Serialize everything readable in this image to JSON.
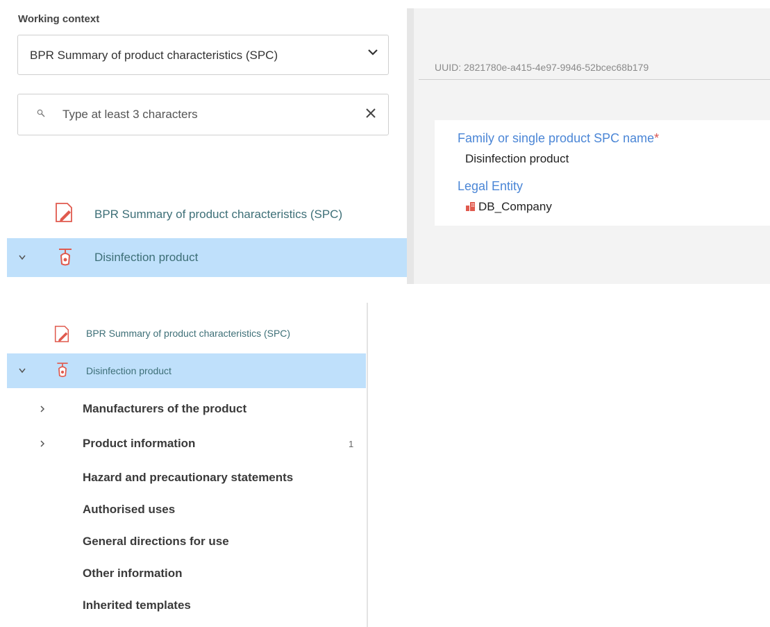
{
  "working_context": {
    "label": "Working context",
    "selected": "BPR Summary of product characteristics (SPC)"
  },
  "search": {
    "placeholder": "Type at least 3 characters"
  },
  "tree": {
    "root_label": "BPR Summary of product characteristics (SPC)",
    "product_label": "Disinfection product"
  },
  "detail": {
    "uuid_text": "UUID: 2821780e-a415-4e97-9946-52bcec68b179",
    "name_label": "Family or single product SPC name",
    "required_mark": "*",
    "name_value": "Disinfection product",
    "legal_entity_label": "Legal Entity",
    "legal_entity_value": "DB_Company"
  },
  "tree2": {
    "root_label": "BPR Summary of product characteristics (SPC)",
    "product_label": "Disinfection product",
    "sections": [
      {
        "label": "Manufacturers of the product",
        "count": ""
      },
      {
        "label": "Product information",
        "count": "1"
      },
      {
        "label": "Hazard and precautionary statements",
        "count": ""
      },
      {
        "label": "Authorised uses",
        "count": ""
      },
      {
        "label": "General directions for use",
        "count": ""
      },
      {
        "label": "Other information",
        "count": ""
      },
      {
        "label": "Inherited templates",
        "count": ""
      }
    ]
  },
  "icons": {
    "document": "document-edit-icon",
    "product": "product-icon",
    "company": "company-icon"
  },
  "colors": {
    "accent": "#4b86d6",
    "selection": "#bfe0fb",
    "tree_text": "#3d6f77",
    "icon_red": "#e05a4e"
  }
}
